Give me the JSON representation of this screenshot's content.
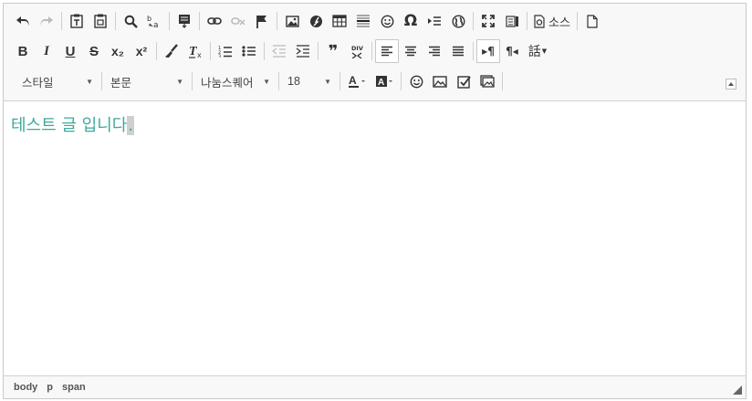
{
  "toolbar": {
    "source_label": "소스",
    "style_combo": "스타일",
    "format_combo": "본문",
    "font_combo": "나눔스퀘어",
    "size_combo": "18",
    "bold": "B",
    "italic": "I",
    "underline": "U",
    "strike": "S",
    "subscript": "x₂",
    "superscript": "x²",
    "blockquote": "❞",
    "rtl_mark": "¶",
    "lang_label": "話"
  },
  "content": {
    "text": "테스트 글 입니다",
    "caret_char": "."
  },
  "status": {
    "crumbs": [
      "body",
      "p",
      "span"
    ]
  },
  "colors": {
    "text": "#3fa99b",
    "toolbar_bg": "#f8f8f8",
    "border": "#c9c9c9"
  }
}
